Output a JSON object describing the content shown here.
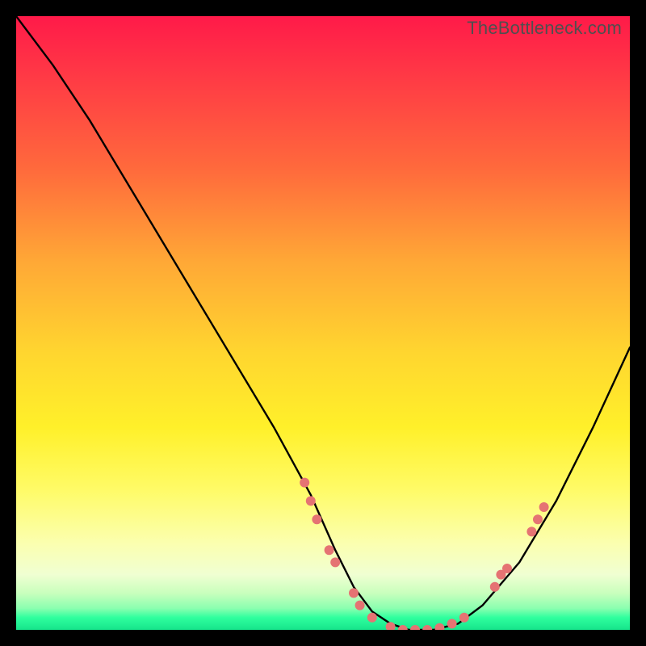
{
  "watermark": "TheBottleneck.com",
  "chart_data": {
    "type": "line",
    "title": "",
    "xlabel": "",
    "ylabel": "",
    "xlim": [
      0,
      100
    ],
    "ylim": [
      0,
      100
    ],
    "curve": {
      "name": "bottleneck-curve",
      "x": [
        0,
        6,
        12,
        18,
        24,
        30,
        36,
        42,
        48,
        52,
        55,
        58,
        61,
        64,
        68,
        72,
        76,
        82,
        88,
        94,
        100
      ],
      "y": [
        100,
        92,
        83,
        73,
        63,
        53,
        43,
        33,
        22,
        13,
        7,
        3,
        1,
        0,
        0,
        1,
        4,
        11,
        21,
        33,
        46
      ]
    },
    "markers": {
      "name": "highlight-points",
      "color": "#e57373",
      "points": [
        {
          "x": 47,
          "y": 24
        },
        {
          "x": 48,
          "y": 21
        },
        {
          "x": 49,
          "y": 18
        },
        {
          "x": 51,
          "y": 13
        },
        {
          "x": 52,
          "y": 11
        },
        {
          "x": 55,
          "y": 6
        },
        {
          "x": 56,
          "y": 4
        },
        {
          "x": 58,
          "y": 2
        },
        {
          "x": 61,
          "y": 0.5
        },
        {
          "x": 63,
          "y": 0
        },
        {
          "x": 65,
          "y": 0
        },
        {
          "x": 67,
          "y": 0
        },
        {
          "x": 69,
          "y": 0.3
        },
        {
          "x": 71,
          "y": 1
        },
        {
          "x": 73,
          "y": 2
        },
        {
          "x": 78,
          "y": 7
        },
        {
          "x": 79,
          "y": 9
        },
        {
          "x": 80,
          "y": 10
        },
        {
          "x": 84,
          "y": 16
        },
        {
          "x": 85,
          "y": 18
        },
        {
          "x": 86,
          "y": 20
        }
      ]
    },
    "background_gradient": {
      "top": "#ff1a49",
      "mid": "#fff02a",
      "bottom": "#16e48b"
    }
  }
}
